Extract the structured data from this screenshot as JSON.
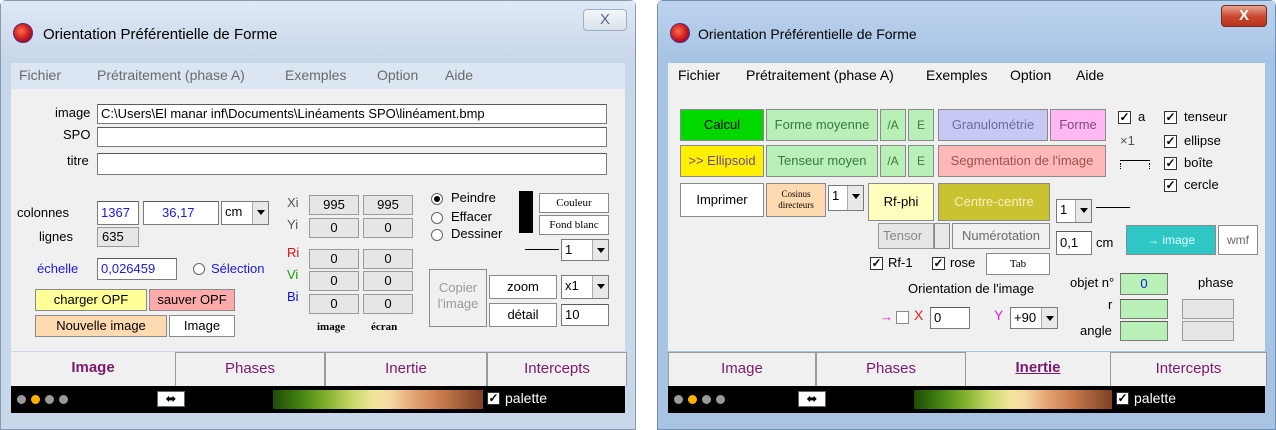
{
  "left": {
    "title": "Orientation Préférentielle de Forme",
    "close": "X",
    "menu": [
      "Fichier",
      "Prétraitement (phase A)",
      "Exemples",
      "Option",
      "Aide"
    ],
    "image_label": "image",
    "image_path": "C:\\Users\\El manar inf\\Documents\\Linéaments SPO\\linéament.bmp",
    "spo_label": "SPO",
    "titre_label": "titre",
    "colonnes_label": "colonnes",
    "colonnes_value": "1367",
    "width_value": "36,17",
    "unit": "cm",
    "lignes_label": "lignes",
    "lignes_value": "635",
    "echelle_label": "échelle",
    "echelle_value": "0,026459",
    "selection_label": "Sélection",
    "charger": "charger OPF",
    "sauver": "sauver OPF",
    "nouvelle": "Nouvelle image",
    "image_btn": "Image",
    "coords": [
      {
        "label": "Xi",
        "v1": "995",
        "v2": "995"
      },
      {
        "label": "Yi",
        "v1": "0",
        "v2": "0"
      },
      {
        "label": "Ri",
        "v1": "0",
        "v2": "0"
      },
      {
        "label": "Vi",
        "v1": "0",
        "v2": "0"
      },
      {
        "label": "Bi",
        "v1": "0",
        "v2": "0"
      }
    ],
    "col_image": "image",
    "col_ecran": "écran",
    "peindre": "Peindre",
    "effacer": "Effacer",
    "dessiner": "Dessiner",
    "couleur": "Couleur",
    "fond_blanc": "Fond blanc",
    "line_width": "1",
    "copier": "Copier l'image",
    "zoom_label": "zoom",
    "zoom_value": "x1",
    "detail_label": "détail",
    "detail_value": "10",
    "tabs": [
      "Image",
      "Phases",
      "Inertie",
      "Intercepts"
    ],
    "palette": "palette",
    "arrow": "⬌"
  },
  "right": {
    "title": "Orientation Préférentielle de Forme",
    "close": "X",
    "menu": [
      "Fichier",
      "Prétraitement (phase A)",
      "Exemples",
      "Option",
      "Aide"
    ],
    "calcul": "Calcul",
    "forme_moyenne": "Forme moyenne",
    "a1": "/A",
    "e1": "E",
    "granulometrie": "Granulométrie",
    "forme": "Forme",
    "ellipsoid": ">> Ellipsoid",
    "tenseur_moyen": "Tenseur moyen",
    "a2": "/A",
    "e2": "E",
    "segmentation": "Segmentation de l'image",
    "imprimer": "Imprimer",
    "cosinus": "Cosinus directeurs",
    "cos_value": "1",
    "rfphi": "Rf-phi",
    "centre": "Centre-centre",
    "tensor": "Tensor",
    "numerotation": "Numérotation",
    "rf1": "Rf-1",
    "rose": "rose",
    "tab_btn": "Tab",
    "orientation": "Orientation de l'image",
    "x_label": "X",
    "x_value": "0",
    "y_label": "Y",
    "y_value": "+90",
    "a_label": "a",
    "x1_label": "×1",
    "checks": [
      "tenseur",
      "ellipse",
      "boîte",
      "cercle"
    ],
    "combo1": "1",
    "cm_value": "0,1",
    "cm_label": "cm",
    "to_image": "→ image",
    "wmf": "wmf",
    "objet_label": "objet n°",
    "objet_value": "0",
    "phase_label": "phase",
    "r_label": "r",
    "angle_label": "angle",
    "tabs": [
      "Image",
      "Phases",
      "Inertie",
      "Intercepts"
    ],
    "palette": "palette",
    "arrow": "⬌"
  },
  "colors": {
    "accent_purple": "#7a1a6e",
    "calcul_green": "#00d800",
    "ellipsoid_yellow": "#ffef00",
    "olive": "#c9c231",
    "teal": "#2fc6c6"
  }
}
